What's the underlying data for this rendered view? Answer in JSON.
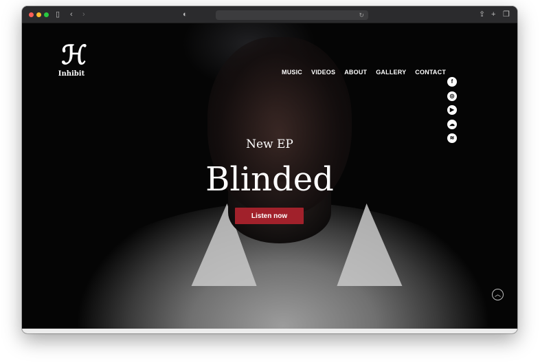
{
  "browser": {
    "icons": [
      "sidebar-icon",
      "back-icon",
      "forward-icon",
      "shield-icon",
      "reload-icon",
      "share-icon",
      "new-tab-icon",
      "tabs-icon"
    ]
  },
  "site": {
    "logo_text": "Inhibit",
    "nav": [
      "MUSIC",
      "VIDEOS",
      "ABOUT",
      "GALLERY",
      "CONTACT"
    ],
    "social_icons": [
      "facebook-icon",
      "instagram-icon",
      "youtube-icon",
      "soundcloud-icon",
      "spotify-icon"
    ],
    "hero": {
      "kicker": "New EP",
      "title": "Blinded",
      "cta": "Listen now"
    }
  },
  "colors": {
    "cta": "#a1212b",
    "background": "#050505",
    "text": "#ffffff"
  }
}
